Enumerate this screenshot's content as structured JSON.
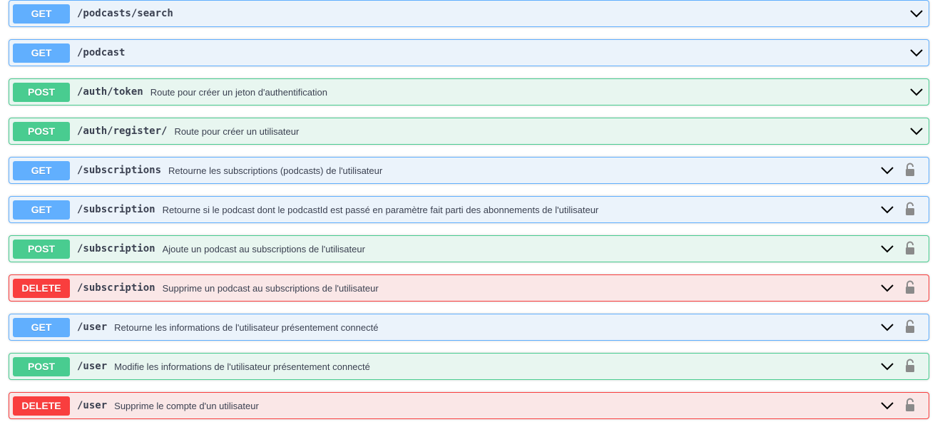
{
  "colors": {
    "get": "#61affe",
    "post": "#49cc90",
    "delete": "#f93e3e"
  },
  "operations": [
    {
      "method": "GET",
      "path": "/podcasts/search",
      "description": "",
      "locked": false
    },
    {
      "method": "GET",
      "path": "/podcast",
      "description": "",
      "locked": false
    },
    {
      "method": "POST",
      "path": "/auth/token",
      "description": "Route pour créer un jeton d'authentification",
      "locked": false
    },
    {
      "method": "POST",
      "path": "/auth/register/",
      "description": "Route pour créer un utilisateur",
      "locked": false
    },
    {
      "method": "GET",
      "path": "/subscriptions",
      "description": "Retourne les subscriptions (podcasts) de l'utilisateur",
      "locked": true
    },
    {
      "method": "GET",
      "path": "/subscription",
      "description": "Retourne si le podcast dont le podcastId est passé en paramètre fait parti des abonnements de l'utilisateur",
      "locked": true
    },
    {
      "method": "POST",
      "path": "/subscription",
      "description": "Ajoute un podcast au subscriptions de l'utilisateur",
      "locked": true
    },
    {
      "method": "DELETE",
      "path": "/subscription",
      "description": "Supprime un podcast au subscriptions de l'utilisateur",
      "locked": true
    },
    {
      "method": "GET",
      "path": "/user",
      "description": "Retourne les informations de l'utilisateur présentement connecté",
      "locked": true
    },
    {
      "method": "POST",
      "path": "/user",
      "description": "Modifie les informations de l'utilisateur présentement connecté",
      "locked": true
    },
    {
      "method": "DELETE",
      "path": "/user",
      "description": "Supprime le compte d'un utilisateur",
      "locked": true
    }
  ],
  "icons": {
    "expand": "chevron-down-icon",
    "lock": "lock-icon"
  }
}
